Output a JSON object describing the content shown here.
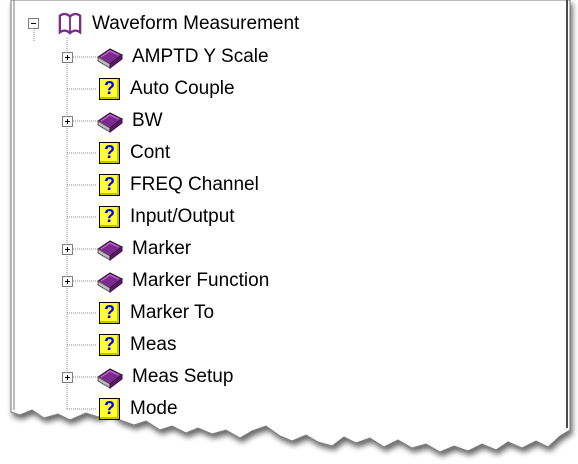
{
  "tree": {
    "root": {
      "label": "Waveform Measurement",
      "icon": "open-book-icon",
      "state": "expanded"
    },
    "items": [
      {
        "label": "AMPTD Y Scale",
        "type": "book",
        "icon": "book-icon",
        "expandable": true
      },
      {
        "label": "Auto Couple",
        "type": "topic",
        "icon": "help-topic-icon",
        "expandable": false
      },
      {
        "label": "BW",
        "type": "book",
        "icon": "book-icon",
        "expandable": true
      },
      {
        "label": "Cont",
        "type": "topic",
        "icon": "help-topic-icon",
        "expandable": false
      },
      {
        "label": "FREQ Channel",
        "type": "topic",
        "icon": "help-topic-icon",
        "expandable": false
      },
      {
        "label": "Input/Output",
        "type": "topic",
        "icon": "help-topic-icon",
        "expandable": false
      },
      {
        "label": "Marker",
        "type": "book",
        "icon": "book-icon",
        "expandable": true
      },
      {
        "label": "Marker Function",
        "type": "book",
        "icon": "book-icon",
        "expandable": true
      },
      {
        "label": "Marker To",
        "type": "topic",
        "icon": "help-topic-icon",
        "expandable": false
      },
      {
        "label": "Meas",
        "type": "topic",
        "icon": "help-topic-icon",
        "expandable": false
      },
      {
        "label": "Meas Setup",
        "type": "book",
        "icon": "book-icon",
        "expandable": true
      },
      {
        "label": "Mode",
        "type": "topic",
        "icon": "help-topic-icon",
        "expandable": false
      }
    ]
  },
  "colors": {
    "book": "#7d2a8e",
    "help_bg": "#ffff33",
    "help_glyph": "#0000ff"
  },
  "help_glyph": "?"
}
